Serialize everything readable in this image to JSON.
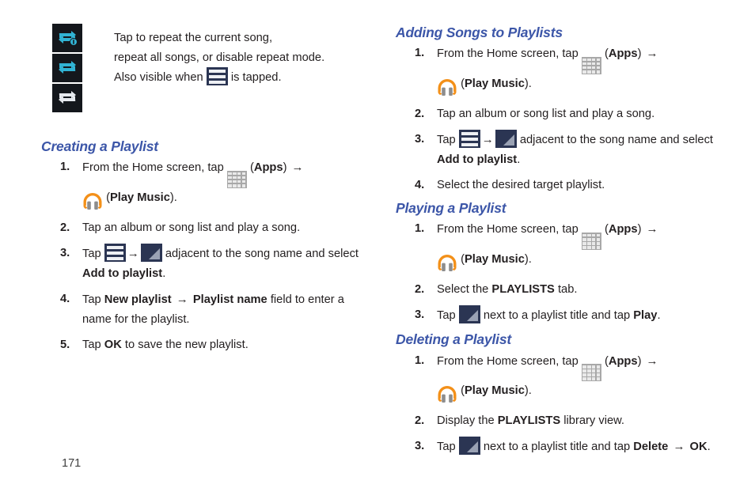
{
  "page": {
    "number": "171",
    "background": "#ffffff",
    "heading_color": "#3c56a8",
    "body_color": "#231f20",
    "icon_navy": "#2b3553",
    "icon_cyan": "#31b3d4",
    "icon_orange": "#f39019",
    "icon_tile_bg": "#14171c"
  },
  "callout": {
    "icons": [
      {
        "name": "repeat-one-icon",
        "state": "repeat current song",
        "color": "#31b3d4"
      },
      {
        "name": "repeat-all-icon",
        "state": "repeat all songs",
        "color": "#31b3d4"
      },
      {
        "name": "repeat-off-icon",
        "state": "repeat disabled",
        "color": "#e6e9ee"
      }
    ],
    "line1": "Tap to repeat the current song,",
    "line2": "repeat all songs, or disable repeat mode.",
    "line3_pre": "Also visible when",
    "line3_post": "is tapped.",
    "inline_icon": "list-menu-icon"
  },
  "sections": [
    {
      "id": "creating-a-playlist",
      "heading": "Creating a Playlist",
      "column": "left",
      "steps": [
        {
          "num": "1.",
          "parts": [
            {
              "t": "text",
              "v": "From the Home screen, tap "
            },
            {
              "t": "icon",
              "v": "apps-grid-icon"
            },
            {
              "t": "text",
              "v": " ("
            },
            {
              "t": "bold",
              "v": "Apps"
            },
            {
              "t": "text",
              "v": ") "
            },
            {
              "t": "arrow",
              "v": "→"
            },
            {
              "t": "break",
              "v": ""
            },
            {
              "t": "icon",
              "v": "play-music-icon"
            },
            {
              "t": "text",
              "v": " ("
            },
            {
              "t": "bold",
              "v": "Play Music"
            },
            {
              "t": "text",
              "v": ")."
            }
          ]
        },
        {
          "num": "2.",
          "parts": [
            {
              "t": "text",
              "v": "Tap an album or song list and play a song."
            }
          ]
        },
        {
          "num": "3.",
          "parts": [
            {
              "t": "text",
              "v": "Tap "
            },
            {
              "t": "icon",
              "v": "list-menu-icon"
            },
            {
              "t": "arrow",
              "v": "→"
            },
            {
              "t": "icon",
              "v": "overflow-corner-icon"
            },
            {
              "t": "text",
              "v": " adjacent to the song name and select "
            },
            {
              "t": "bold",
              "v": "Add to playlist"
            },
            {
              "t": "text",
              "v": "."
            }
          ]
        },
        {
          "num": "4.",
          "parts": [
            {
              "t": "text",
              "v": "Tap "
            },
            {
              "t": "bold",
              "v": "New playlist"
            },
            {
              "t": "text",
              "v": " "
            },
            {
              "t": "arrow",
              "v": "→"
            },
            {
              "t": "text",
              "v": " "
            },
            {
              "t": "bold",
              "v": "Playlist name"
            },
            {
              "t": "text",
              "v": " field to enter a name for the playlist."
            }
          ]
        },
        {
          "num": "5.",
          "parts": [
            {
              "t": "text",
              "v": "Tap "
            },
            {
              "t": "bold",
              "v": "OK"
            },
            {
              "t": "text",
              "v": " to save the new playlist."
            }
          ]
        }
      ]
    },
    {
      "id": "adding-songs-to-playlists",
      "heading": "Adding Songs to Playlists",
      "column": "right",
      "steps": [
        {
          "num": "1.",
          "parts": [
            {
              "t": "text",
              "v": "From the Home screen, tap "
            },
            {
              "t": "icon",
              "v": "apps-grid-icon"
            },
            {
              "t": "text",
              "v": " ("
            },
            {
              "t": "bold",
              "v": "Apps"
            },
            {
              "t": "text",
              "v": ") "
            },
            {
              "t": "arrow",
              "v": "→"
            },
            {
              "t": "break",
              "v": ""
            },
            {
              "t": "icon",
              "v": "play-music-icon"
            },
            {
              "t": "text",
              "v": " ("
            },
            {
              "t": "bold",
              "v": "Play Music"
            },
            {
              "t": "text",
              "v": ")."
            }
          ]
        },
        {
          "num": "2.",
          "parts": [
            {
              "t": "text",
              "v": "Tap an album or song list and play a song."
            }
          ]
        },
        {
          "num": "3.",
          "parts": [
            {
              "t": "text",
              "v": "Tap "
            },
            {
              "t": "icon",
              "v": "list-menu-icon"
            },
            {
              "t": "arrow",
              "v": "→"
            },
            {
              "t": "icon",
              "v": "overflow-corner-icon"
            },
            {
              "t": "text",
              "v": " adjacent to the song name and select "
            },
            {
              "t": "bold",
              "v": "Add to playlist"
            },
            {
              "t": "text",
              "v": "."
            }
          ]
        },
        {
          "num": "4.",
          "parts": [
            {
              "t": "text",
              "v": "Select the desired target playlist."
            }
          ]
        }
      ]
    },
    {
      "id": "playing-a-playlist",
      "heading": "Playing a Playlist",
      "column": "right",
      "steps": [
        {
          "num": "1.",
          "parts": [
            {
              "t": "text",
              "v": "From the Home screen, tap "
            },
            {
              "t": "icon",
              "v": "apps-grid-icon"
            },
            {
              "t": "text",
              "v": " ("
            },
            {
              "t": "bold",
              "v": "Apps"
            },
            {
              "t": "text",
              "v": ") "
            },
            {
              "t": "arrow",
              "v": "→"
            },
            {
              "t": "break",
              "v": ""
            },
            {
              "t": "icon",
              "v": "play-music-icon"
            },
            {
              "t": "text",
              "v": " ("
            },
            {
              "t": "bold",
              "v": "Play Music"
            },
            {
              "t": "text",
              "v": ")."
            }
          ]
        },
        {
          "num": "2.",
          "parts": [
            {
              "t": "text",
              "v": "Select the "
            },
            {
              "t": "bold",
              "v": "PLAYLISTS"
            },
            {
              "t": "text",
              "v": " tab."
            }
          ]
        },
        {
          "num": "3.",
          "parts": [
            {
              "t": "text",
              "v": "Tap "
            },
            {
              "t": "icon",
              "v": "overflow-corner-icon"
            },
            {
              "t": "text",
              "v": " next to a playlist title and tap "
            },
            {
              "t": "bold",
              "v": "Play"
            },
            {
              "t": "text",
              "v": "."
            }
          ]
        }
      ]
    },
    {
      "id": "deleting-a-playlist",
      "heading": "Deleting a Playlist",
      "column": "right",
      "steps": [
        {
          "num": "1.",
          "parts": [
            {
              "t": "text",
              "v": "From the Home screen, tap "
            },
            {
              "t": "icon",
              "v": "apps-grid-icon"
            },
            {
              "t": "text",
              "v": " ("
            },
            {
              "t": "bold",
              "v": "Apps"
            },
            {
              "t": "text",
              "v": ") "
            },
            {
              "t": "arrow",
              "v": "→"
            },
            {
              "t": "break",
              "v": ""
            },
            {
              "t": "icon",
              "v": "play-music-icon"
            },
            {
              "t": "text",
              "v": " ("
            },
            {
              "t": "bold",
              "v": "Play Music"
            },
            {
              "t": "text",
              "v": ")."
            }
          ]
        },
        {
          "num": "2.",
          "parts": [
            {
              "t": "text",
              "v": "Display the "
            },
            {
              "t": "bold",
              "v": "PLAYLISTS"
            },
            {
              "t": "text",
              "v": " library view."
            }
          ]
        },
        {
          "num": "3.",
          "parts": [
            {
              "t": "text",
              "v": "Tap "
            },
            {
              "t": "icon",
              "v": "overflow-corner-icon"
            },
            {
              "t": "text",
              "v": " next to a playlist title and tap "
            },
            {
              "t": "bold",
              "v": "Delete"
            },
            {
              "t": "text",
              "v": " "
            },
            {
              "t": "arrow",
              "v": "→"
            },
            {
              "t": "text",
              "v": " "
            },
            {
              "t": "bold",
              "v": "OK"
            },
            {
              "t": "text",
              "v": "."
            }
          ]
        }
      ]
    }
  ]
}
